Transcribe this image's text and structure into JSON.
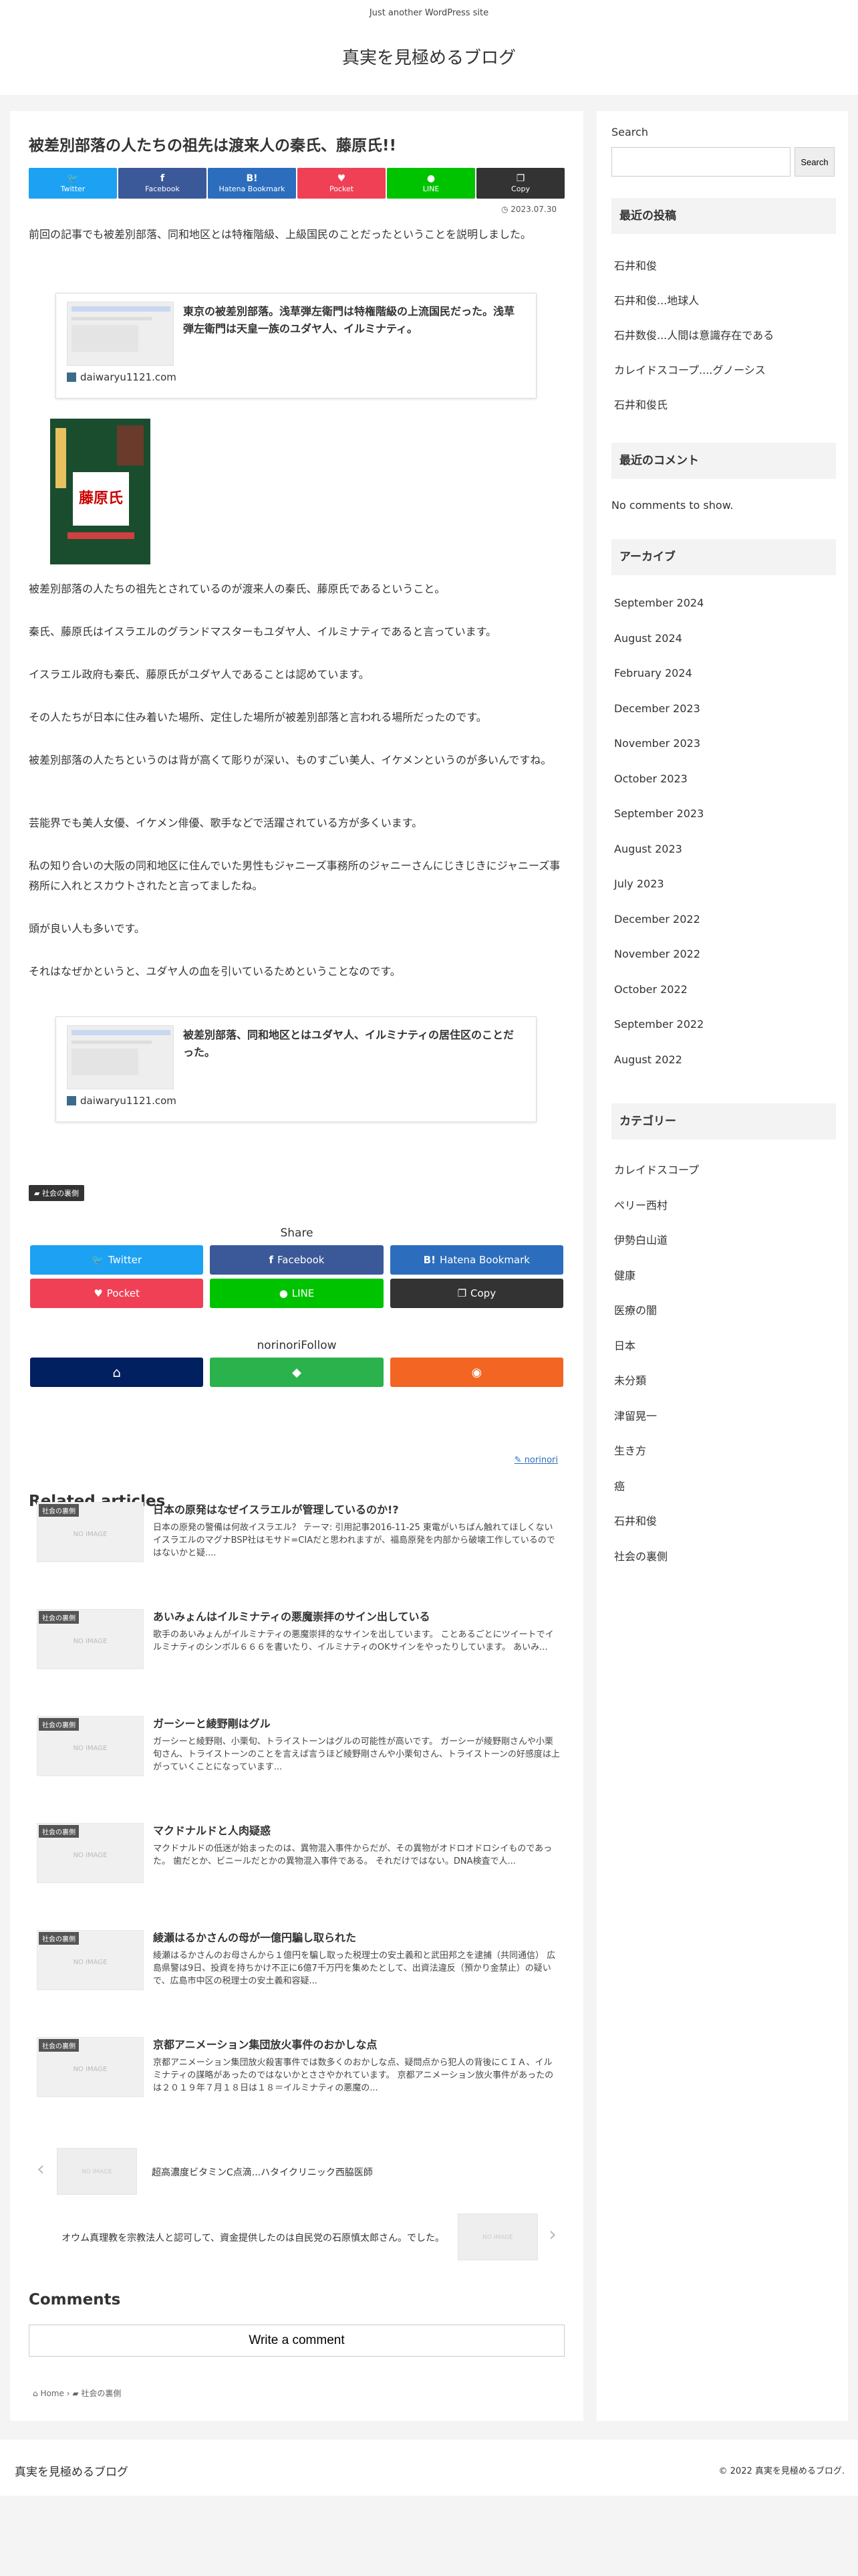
{
  "header": {
    "tagline": "Just another WordPress site",
    "title": "真実を見極めるブログ"
  },
  "article": {
    "title": "被差別部落の人たちの祖先は渡来人の秦氏、藤原氏!!",
    "date": "2023.07.30",
    "date_icon": "clock-icon",
    "share_top": [
      {
        "label": "Twitter",
        "icon": "twitter-icon",
        "color": "#1da1f2"
      },
      {
        "label": "Facebook",
        "icon": "facebook-icon",
        "color": "#3b5998"
      },
      {
        "label": "Hatena Bookmark",
        "icon": "hatena-icon",
        "glyph": "B!",
        "color": "#2c6ebd"
      },
      {
        "label": "Pocket",
        "icon": "pocket-icon",
        "color": "#ef4056"
      },
      {
        "label": "LINE",
        "icon": "line-icon",
        "color": "#00c300"
      },
      {
        "label": "Copy",
        "icon": "copy-icon",
        "color": "#333333"
      }
    ],
    "intro": "前回の記事でも被差別部落、同和地区とは特権階級、上級国民のことだったということを説明しました。",
    "card1": {
      "title": "東京の被差別部落。浅草弾左衛門は特権階級の上流国民だった。浅草弾左衛門は天皇一族のユダヤ人、イルミナティ。",
      "domain": "daiwaryu1121.com"
    },
    "book_text": "藤原氏",
    "paragraphs": [
      "被差別部落の人たちの祖先とされているのが渡来人の秦氏、藤原氏であるということ。",
      "秦氏、藤原氏はイスラエルのグランドマスターもユダヤ人、イルミナティであると言っています。",
      "イスラエル政府も秦氏、藤原氏がユダヤ人であることは認めています。",
      "その人たちが日本に住み着いた場所、定住した場所が被差別部落と言われる場所だったのです。",
      "被差別部落の人たちというのは背が高くて彫りが深い、ものすごい美人、イケメンというのが多いんですね。",
      "芸能界でも美人女優、イケメン俳優、歌手などで活躍されている方が多くいます。",
      "私の知り合いの大阪の同和地区に住んでいた男性もジャニーズ事務所のジャニーさんにじきじきにジャニーズ事務所に入れとスカウトされたと言ってましたね。",
      "頭が良い人も多いです。",
      "それはなぜかというと、ユダヤ人の血を引いているためということなのです。"
    ],
    "card2": {
      "title": "被差別部落、同和地区とはユダヤ人、イルミナティの居住区のことだった。",
      "domain": "daiwaryu1121.com"
    },
    "category_tag": "社会の裏側",
    "share_heading": "Share",
    "share_bottom": [
      {
        "label": "Twitter",
        "icon": "twitter-icon",
        "color": "#1da1f2"
      },
      {
        "label": "Facebook",
        "icon": "facebook-icon",
        "color": "#3b5998"
      },
      {
        "label": "Hatena Bookmark",
        "icon": "hatena-icon",
        "glyph": "B!",
        "color": "#2c6ebd"
      },
      {
        "label": "Pocket",
        "icon": "pocket-icon",
        "color": "#ef4056"
      },
      {
        "label": "LINE",
        "icon": "line-icon",
        "color": "#00c300"
      },
      {
        "label": "Copy",
        "icon": "copy-icon",
        "color": "#333333"
      }
    ],
    "follow_heading": "norinoriFollow",
    "follow": [
      {
        "icon": "home-icon",
        "color": "#002060"
      },
      {
        "icon": "feedly-icon",
        "color": "#2bb24c"
      },
      {
        "icon": "rss-icon",
        "color": "#f26522"
      }
    ],
    "author": "norinori"
  },
  "related": {
    "heading": "Related articles",
    "no_image": "NO IMAGE",
    "items": [
      {
        "badge": "社会の裏側",
        "title": "日本の原発はなぜイスラエルが管理しているのか!?",
        "snippet": "日本の原発の警備は何故イスラエル？ テーマ: 引用記事2016-11-25 東電がいちばん触れてほしくないイスラエルのマグナBSP社はモサド=CIAだと思われますが、福島原発を内部から破壊工作しているのではないかと疑...."
      },
      {
        "badge": "社会の裏側",
        "title": "あいみょんはイルミナティの悪魔崇拝のサイン出している",
        "snippet": "歌手のあいみょんがイルミナティの悪魔崇拝的なサインを出しています。 ことあるごとにツイートでイルミナティのシンボル６６６を書いたり、イルミナティのOKサインをやったりしています。 あいみ..."
      },
      {
        "badge": "社会の裏側",
        "title": "ガーシーと綾野剛はグル",
        "snippet": "ガーシーと綾野剛、小栗旬、トライストーンはグルの可能性が高いです。 ガーシーが綾野剛さんや小栗旬さん、トライストーンのことを言えば言うほど綾野剛さんや小栗旬さん、トライストーンの好感度は上がっていくことになっています..."
      },
      {
        "badge": "社会の裏側",
        "title": "マクドナルドと人肉疑惑",
        "snippet": "マクドナルドの低迷が始まったのは、異物混入事件からだが、その異物がオドロオドロシイものであった。 歯だとか、ビニールだとかの異物混入事件である。 それだけではない。DNA検査で人..."
      },
      {
        "badge": "社会の裏側",
        "title": "綾瀬はるかさんの母が一億円騙し取られた",
        "snippet": "綾瀬はるかさんのお母さんから１億円を騙し取った税理士の安土義和と武田邦之を逮捕（共同通信） 広島県警は9日、投資を持ちかけ不正に6億7千万円を集めたとして、出資法違反（預かり金禁止）の疑いで、広島市中区の税理士の安土義和容疑..."
      },
      {
        "badge": "社会の裏側",
        "title": "京都アニメーション集団放火事件のおかしな点",
        "snippet": "京都アニメーション集団放火殺害事件では数多くのおかしな点、疑問点から犯人の背後にＣＩＡ、イルミナティの謀略があったのではないかとささやかれています。 京都アニメーション放火事件があったのは２０１９年７月１８日は１８＝イルミナティの悪魔の..."
      }
    ]
  },
  "post_nav": {
    "prev": {
      "title": "超高濃度ビタミンC点滴...ハタイクリニック西脇医師",
      "icon": "chevron-left-icon"
    },
    "next": {
      "title": "オウム真理教を宗教法人と認可して、資金提供したのは自民党の石原慎太郎さん。でした。",
      "icon": "chevron-right-icon"
    }
  },
  "comments": {
    "heading": "Comments",
    "button": "Write a comment"
  },
  "breadcrumb": {
    "home": "Home",
    "home_icon": "home-icon",
    "category": "社会の裏側",
    "category_icon": "folder-icon"
  },
  "sidebar": {
    "search_label": "Search",
    "search_placeholder": "",
    "search_button": "Search",
    "recent_posts_heading": "最近の投稿",
    "recent_posts": [
      "石井和俊",
      "石井和俊...地球人",
      "石井数俊...人間は意識存在である",
      "カレイドスコープ....グノーシス",
      "石井和俊氏"
    ],
    "recent_comments_heading": "最近のコメント",
    "no_comments": "No comments to show.",
    "archives_heading": "アーカイブ",
    "archives": [
      "September 2024",
      "August 2024",
      "February 2024",
      "December 2023",
      "November 2023",
      "October 2023",
      "September 2023",
      "August 2023",
      "July 2023",
      "December 2022",
      "November 2022",
      "October 2022",
      "September 2022",
      "August 2022"
    ],
    "categories_heading": "カテゴリー",
    "categories": [
      "カレイドスコープ",
      "ペリー西村",
      "伊勢白山道",
      "健康",
      "医療の闇",
      "日本",
      "未分類",
      "津留晃一",
      "生き方",
      "癌",
      "石井和俊",
      "社会の裏側"
    ]
  },
  "footer": {
    "site": "真実を見極めるブログ",
    "copyright": "© 2022 真実を見極めるブログ."
  }
}
